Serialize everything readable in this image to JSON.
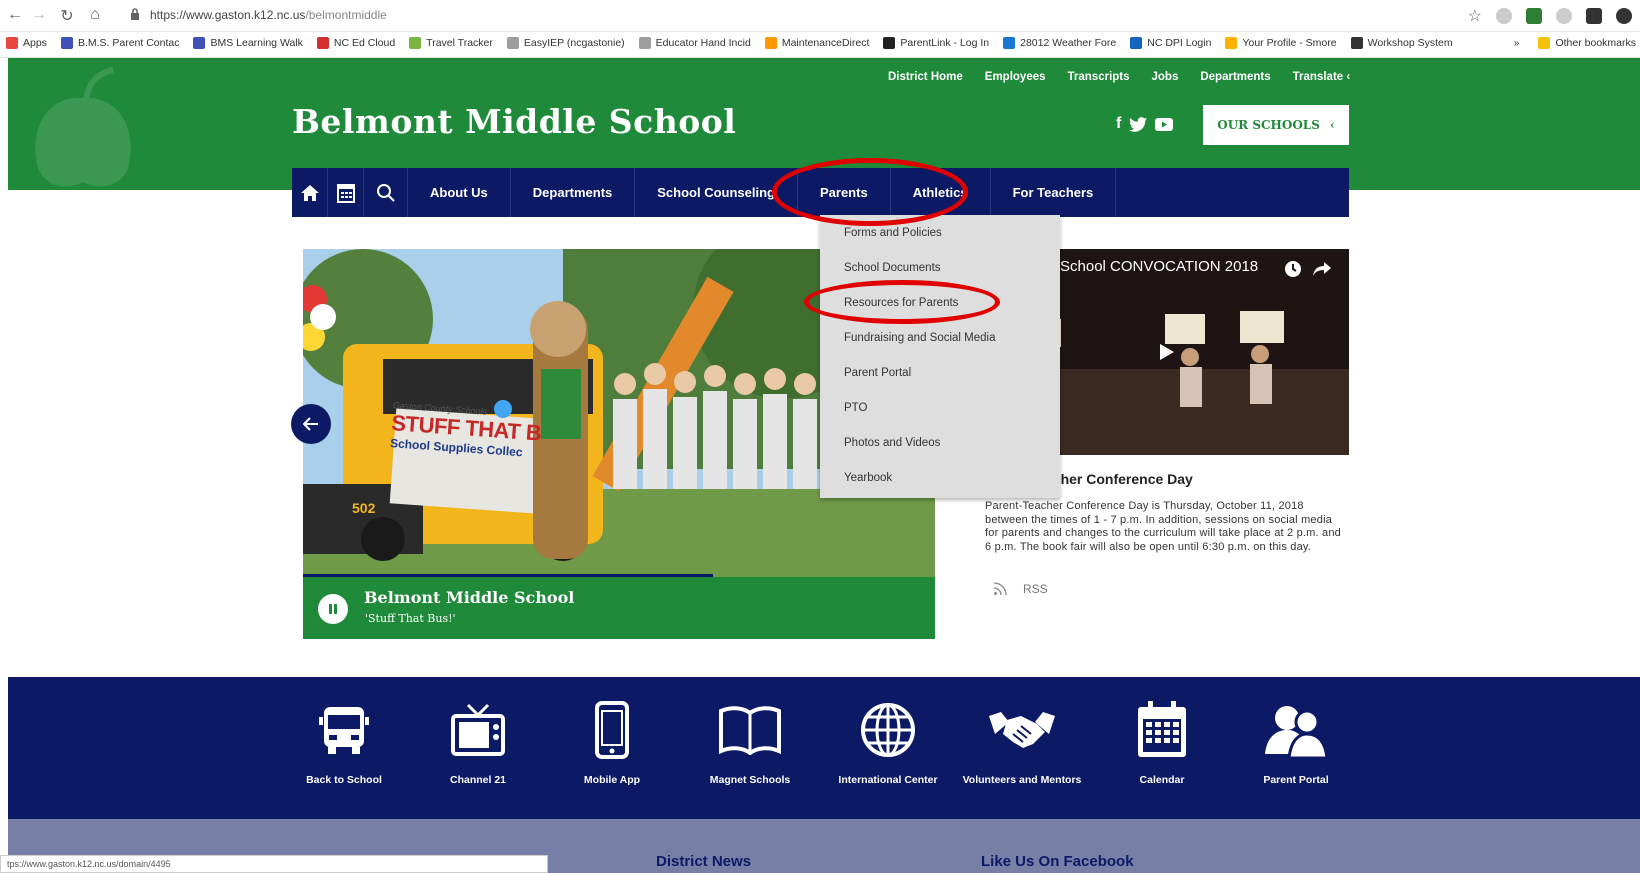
{
  "browser": {
    "url_host": "https://www.gaston.k12.nc.us",
    "url_path": "/belmontmiddle",
    "bookmarks": [
      {
        "label": "Apps",
        "color": "#e8453c"
      },
      {
        "label": "B.M.S. Parent Contac",
        "color": "#3f51b5"
      },
      {
        "label": "BMS Learning Walk",
        "color": "#3f51b5"
      },
      {
        "label": "NC Ed Cloud",
        "color": "#d32f2f"
      },
      {
        "label": "Travel Tracker",
        "color": "#7cb342"
      },
      {
        "label": "EasyIEP (ncgastonie)",
        "color": "#9e9e9e"
      },
      {
        "label": "Educator Hand Incid",
        "color": "#9e9e9e"
      },
      {
        "label": "MaintenanceDirect",
        "color": "#ff9800"
      },
      {
        "label": "ParentLink - Log In",
        "color": "#222222"
      },
      {
        "label": "28012 Weather Fore",
        "color": "#1976d2"
      },
      {
        "label": "NC DPI Login",
        "color": "#1565c0"
      },
      {
        "label": "Your Profile - Smore",
        "color": "#ffb300"
      },
      {
        "label": "Workshop System",
        "color": "#333333"
      }
    ],
    "more_bookmarks": "»",
    "other_bookmarks": "Other bookmarks",
    "status_url": "tps://www.gaston.k12.nc.us/domain/4495"
  },
  "header": {
    "util_links": [
      "District Home",
      "Employees",
      "Transcripts",
      "Jobs",
      "Departments",
      "Translate"
    ],
    "title": "Belmont Middle School",
    "social": {
      "facebook": "f"
    },
    "our_schools": "OUR SCHOOLS"
  },
  "nav": {
    "items": [
      "About Us",
      "Departments",
      "School Counseling",
      "Parents",
      "Athletics",
      "For Teachers"
    ]
  },
  "dropdown": {
    "items": [
      "Forms and Policies",
      "School Documents",
      "Resources for Parents",
      "Fundraising and Social Media",
      "Parent Portal",
      "PTO",
      "Photos and Videos",
      "Yearbook"
    ]
  },
  "carousel": {
    "title": "Belmont Middle School",
    "subtitle": "'Stuff That Bus!'",
    "banner_line1": "STUFF THAT B",
    "banner_line2": "School Supplies Collec",
    "banner_top": "Gaston County Schools",
    "bus_number": "502"
  },
  "video": {
    "title": "School CONVOCATION 2018"
  },
  "news": {
    "title": "acher Conference Day",
    "body": "Parent-Teacher Conference Day is Thursday, October 11, 2018 between the times of 1 - 7 p.m. In addition, sessions on social media for parents and changes to the curriculum will take place at 2 p.m. and 6 p.m. The book fair will also be open until 6:30 p.m. on this day.",
    "rss": "RSS"
  },
  "quick_links": [
    {
      "label": "Back to School",
      "icon": "school-bus-icon"
    },
    {
      "label": "Channel 21",
      "icon": "tv-icon"
    },
    {
      "label": "Mobile App",
      "icon": "mobile-icon"
    },
    {
      "label": "Magnet Schools",
      "icon": "book-icon"
    },
    {
      "label": "International Center",
      "icon": "globe-icon"
    },
    {
      "label": "Volunteers and Mentors",
      "icon": "handshake-icon"
    },
    {
      "label": "Calendar",
      "icon": "calendar-icon"
    },
    {
      "label": "Parent Portal",
      "icon": "users-icon"
    }
  ],
  "footer": {
    "district_news": "District News",
    "facebook": "Like Us On Facebook"
  },
  "colors": {
    "green": "#1f8a3a",
    "navy": "#0c1a66",
    "annotation_red": "#e00000"
  }
}
